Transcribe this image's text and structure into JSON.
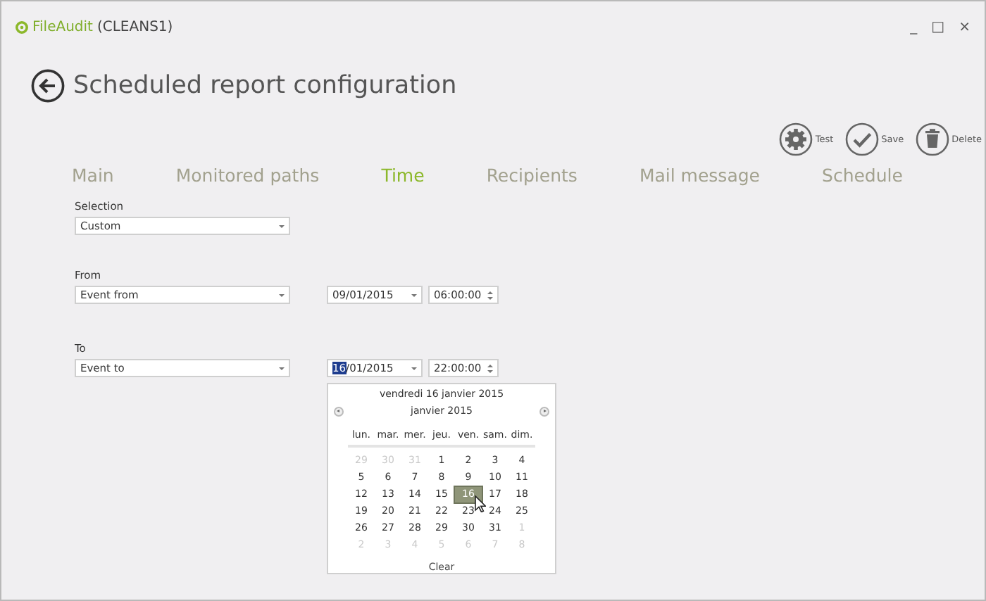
{
  "window": {
    "app_name": "FileAudit",
    "server": "(CLEANS1)",
    "controls": [
      "_",
      "□",
      "×"
    ]
  },
  "page_title": "Scheduled report configuration",
  "toolbar": [
    {
      "kind": "gear",
      "label": "Test"
    },
    {
      "kind": "check",
      "label": "Save"
    },
    {
      "kind": "trash",
      "label": "Delete"
    }
  ],
  "tabs": [
    {
      "label": "Main",
      "selected": false
    },
    {
      "label": "Monitored paths",
      "selected": false
    },
    {
      "label": "Time",
      "selected": true
    },
    {
      "label": "Recipients",
      "selected": false
    },
    {
      "label": "Mail message",
      "selected": false
    },
    {
      "label": "Schedule",
      "selected": false
    }
  ],
  "selection": {
    "label": "Selection",
    "value": "Custom"
  },
  "from": {
    "label": "From",
    "value": "Event from",
    "date": {
      "rest": "09/01/2015"
    },
    "time": "06:00:00"
  },
  "to": {
    "label": "To",
    "value": "Event to",
    "date": {
      "highlighted": "16",
      "rest": "/01/2015"
    },
    "time": "22:00:00"
  },
  "calendar": {
    "full_date": "vendredi 16 janvier 2015",
    "month": "janvier 2015",
    "weekdays": [
      "lun.",
      "mar.",
      "mer.",
      "jeu.",
      "ven.",
      "sam.",
      "dim."
    ],
    "weeks": [
      [
        {
          "day": "29",
          "muted": true,
          "selected": false
        },
        {
          "day": "30",
          "muted": true,
          "selected": false
        },
        {
          "day": "31",
          "muted": true,
          "selected": false
        },
        {
          "day": "1",
          "muted": false,
          "selected": false
        },
        {
          "day": "2",
          "muted": false,
          "selected": false
        },
        {
          "day": "3",
          "muted": false,
          "selected": false
        },
        {
          "day": "4",
          "muted": false,
          "selected": false
        }
      ],
      [
        {
          "day": "5",
          "muted": false,
          "selected": false
        },
        {
          "day": "6",
          "muted": false,
          "selected": false
        },
        {
          "day": "7",
          "muted": false,
          "selected": false
        },
        {
          "day": "8",
          "muted": false,
          "selected": false
        },
        {
          "day": "9",
          "muted": false,
          "selected": false
        },
        {
          "day": "10",
          "muted": false,
          "selected": false
        },
        {
          "day": "11",
          "muted": false,
          "selected": false
        }
      ],
      [
        {
          "day": "12",
          "muted": false,
          "selected": false
        },
        {
          "day": "13",
          "muted": false,
          "selected": false
        },
        {
          "day": "14",
          "muted": false,
          "selected": false
        },
        {
          "day": "15",
          "muted": false,
          "selected": false
        },
        {
          "day": "16",
          "muted": false,
          "selected": true
        },
        {
          "day": "17",
          "muted": false,
          "selected": false
        },
        {
          "day": "18",
          "muted": false,
          "selected": false
        }
      ],
      [
        {
          "day": "19",
          "muted": false,
          "selected": false
        },
        {
          "day": "20",
          "muted": false,
          "selected": false
        },
        {
          "day": "21",
          "muted": false,
          "selected": false
        },
        {
          "day": "22",
          "muted": false,
          "selected": false
        },
        {
          "day": "23",
          "muted": false,
          "selected": false
        },
        {
          "day": "24",
          "muted": false,
          "selected": false
        },
        {
          "day": "25",
          "muted": false,
          "selected": false
        }
      ],
      [
        {
          "day": "26",
          "muted": false,
          "selected": false
        },
        {
          "day": "27",
          "muted": false,
          "selected": false
        },
        {
          "day": "28",
          "muted": false,
          "selected": false
        },
        {
          "day": "29",
          "muted": false,
          "selected": false
        },
        {
          "day": "30",
          "muted": false,
          "selected": false
        },
        {
          "day": "31",
          "muted": false,
          "selected": false
        },
        {
          "day": "1",
          "muted": true,
          "selected": false
        }
      ],
      [
        {
          "day": "2",
          "muted": true,
          "selected": false
        },
        {
          "day": "3",
          "muted": true,
          "selected": false
        },
        {
          "day": "4",
          "muted": true,
          "selected": false
        },
        {
          "day": "5",
          "muted": true,
          "selected": false
        },
        {
          "day": "6",
          "muted": true,
          "selected": false
        },
        {
          "day": "7",
          "muted": true,
          "selected": false
        },
        {
          "day": "8",
          "muted": true,
          "selected": false
        }
      ]
    ],
    "clear": "Clear"
  }
}
